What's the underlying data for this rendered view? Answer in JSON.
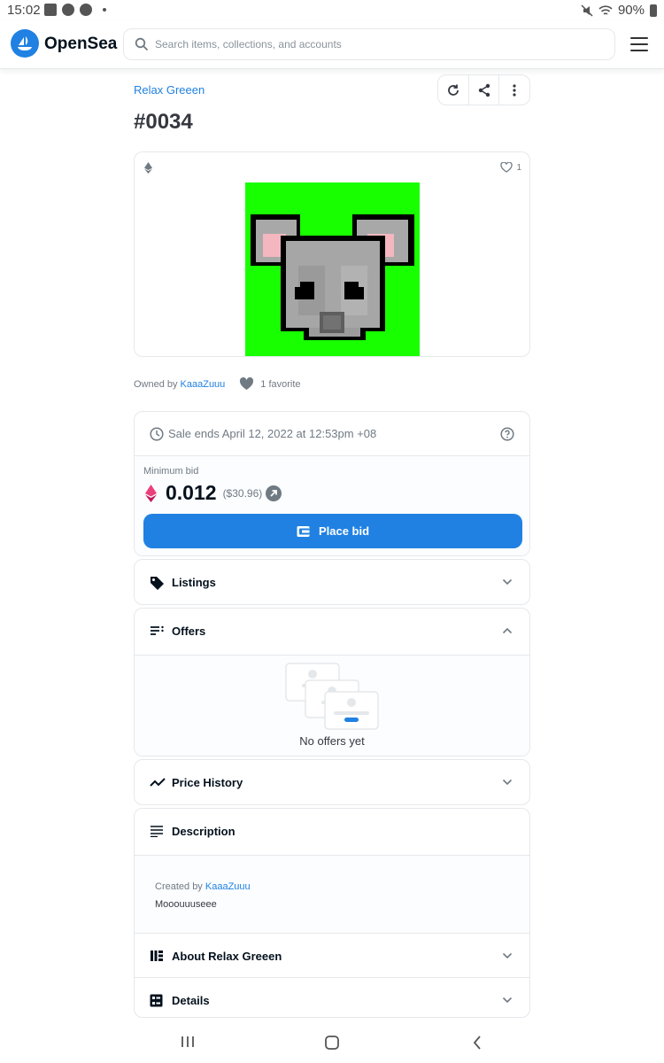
{
  "status": {
    "time": "15:02",
    "battery": "90%"
  },
  "header": {
    "brand": "OpenSea",
    "search_placeholder": "Search items, collections, and accounts",
    "accent": "#2081e2"
  },
  "item": {
    "collection": "Relax Greeen",
    "title": "#0034",
    "favorites_count": "1",
    "owned_prefix": "Owned by",
    "owner": "KaaaZuuu",
    "favorites_label": "1 favorite",
    "art_background": "#18ff00"
  },
  "sale": {
    "ends_text": "Sale ends April 12, 2022 at 12:53pm +08",
    "min_bid_label": "Minimum bid",
    "price": "0.012",
    "usd": "($30.96)",
    "place_bid_label": "Place bid"
  },
  "panels": {
    "listings": "Listings",
    "offers": "Offers",
    "no_offers": "No offers yet",
    "price_history": "Price History",
    "description": "Description",
    "created_prefix": "Created by",
    "creator": "KaaaZuuu",
    "description_text": "Mooouuuseee",
    "about": "About Relax Greeen",
    "details": "Details"
  },
  "icons": {
    "logo": "opensea-boat-icon",
    "search": "search-icon",
    "menu": "hamburger-icon",
    "refresh": "refresh-icon",
    "share": "share-icon",
    "more": "more-vertical-icon",
    "eth": "ethereum-icon",
    "heart": "heart-icon",
    "clock": "clock-icon",
    "help": "help-icon",
    "wallet": "wallet-icon",
    "tag": "tag-icon",
    "offers": "list-icon",
    "chart": "trending-icon",
    "description": "text-lines-icon",
    "about": "book-icon",
    "details": "details-icon"
  }
}
